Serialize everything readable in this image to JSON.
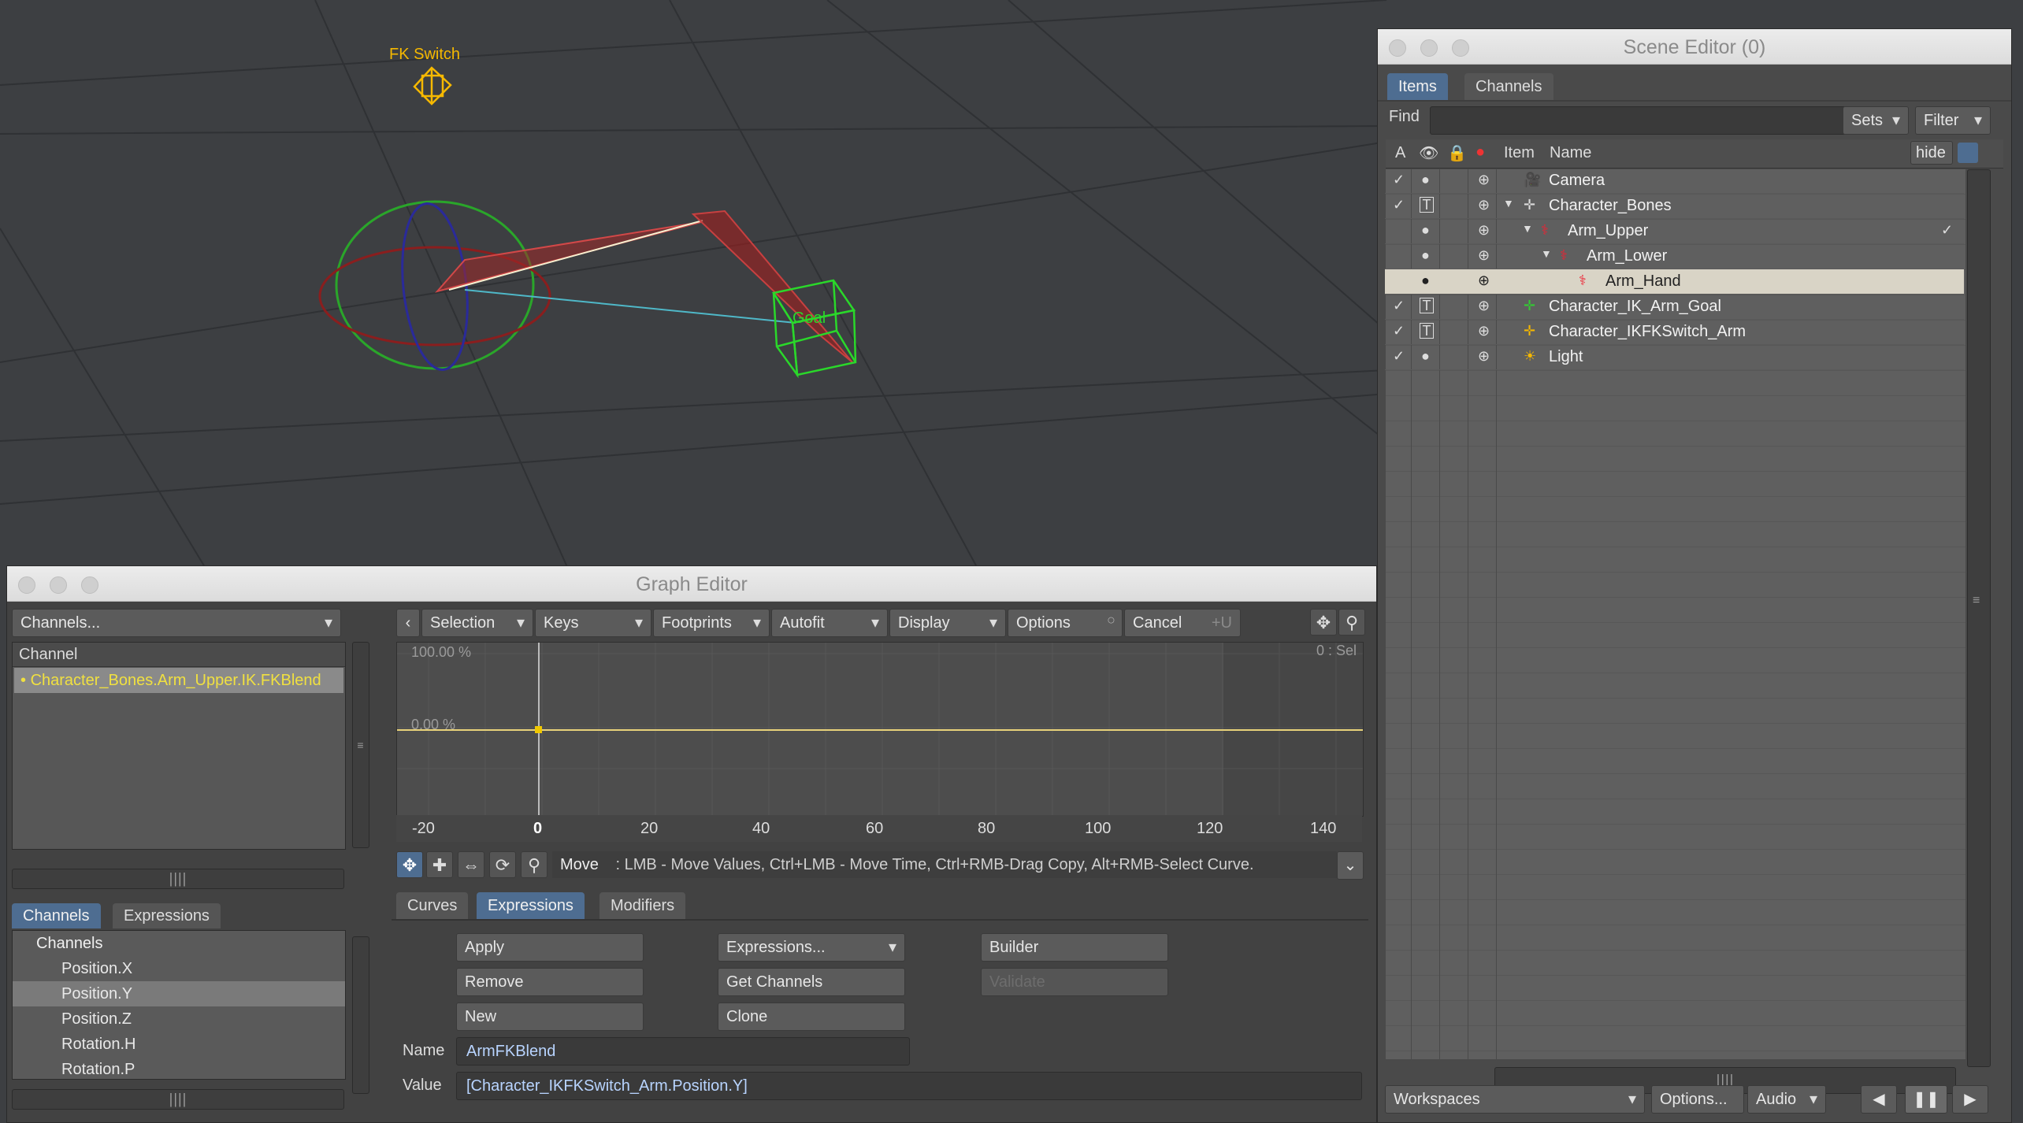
{
  "viewport": {
    "fk_switch_label": "FK Switch",
    "goal_label": "Goal"
  },
  "scene_editor": {
    "title": "Scene Editor (0)",
    "tabs": [
      "Items",
      "Channels"
    ],
    "find_label": "Find",
    "find_value": "",
    "sets_label": "Sets",
    "filter_label": "Filter",
    "col_a": "A",
    "col_item": "Item",
    "col_name": "Name",
    "hide_label": "hide",
    "items": [
      {
        "name": "Camera",
        "check": "✓",
        "vis": "●",
        "tvis": false,
        "icon": "camera-icon"
      },
      {
        "name": "Character_Bones",
        "check": "✓",
        "vis": "T",
        "tvis": true,
        "icon": "null-icon"
      },
      {
        "name": "Arm_Upper",
        "check": "",
        "vis": "●",
        "tvis": false,
        "icon": "bone-icon",
        "right": "✓"
      },
      {
        "name": "Arm_Lower",
        "check": "",
        "vis": "●",
        "tvis": false,
        "icon": "bone-icon"
      },
      {
        "name": "Arm_Hand",
        "check": "",
        "vis": "●",
        "tvis": false,
        "icon": "bone-icon"
      },
      {
        "name": "Character_IK_Arm_Goal",
        "check": "✓",
        "vis": "T",
        "tvis": true,
        "icon": "null-green-icon"
      },
      {
        "name": "Character_IKFKSwitch_Arm",
        "check": "✓",
        "vis": "T",
        "tvis": true,
        "icon": "null-yellow-icon"
      },
      {
        "name": "Light",
        "check": "✓",
        "vis": "●",
        "tvis": false,
        "icon": "light-icon"
      }
    ],
    "workspaces_label": "Workspaces",
    "options_label": "Options...",
    "audio_label": "Audio"
  },
  "graph_editor": {
    "title": "Graph Editor",
    "channels_dropdown": "Channels...",
    "channel_header": "Channel",
    "channel_item": "Character_Bones.Arm_Upper.IK.FKBlend",
    "lower_tabs": [
      "Channels",
      "Expressions"
    ],
    "channels_tree_header": "Channels",
    "channels_list": [
      "Position.X",
      "Position.Y",
      "Position.Z",
      "Rotation.H",
      "Rotation.P"
    ],
    "toolbar": {
      "selection": "Selection",
      "keys": "Keys",
      "footprints": "Footprints",
      "autofit": "Autofit",
      "display": "Display",
      "options": "Options",
      "cancel": "Cancel",
      "shortcut": "+U"
    },
    "graph": {
      "top_label": "100.00 %",
      "mid_label": "0.00 %",
      "sel_label": "0 : Sel",
      "x_ticks": [
        "-20",
        "0",
        "20",
        "40",
        "60",
        "80",
        "100",
        "120",
        "140"
      ]
    },
    "status": {
      "mode": "Move",
      "hint": ":  LMB - Move Values, Ctrl+LMB - Move Time, Ctrl+RMB-Drag Copy, Alt+RMB-Select Curve."
    },
    "bottom_tabs": [
      "Curves",
      "Expressions",
      "Modifiers"
    ],
    "buttons": {
      "apply": "Apply",
      "remove": "Remove",
      "new": "New",
      "expressions_dd": "Expressions...",
      "get_channels": "Get Channels",
      "clone": "Clone",
      "builder": "Builder",
      "validate": "Validate"
    },
    "name_label": "Name",
    "name_value": "ArmFKBlend",
    "value_label": "Value",
    "value_value": "[Character_IKFKSwitch_Arm.Position.Y]"
  },
  "colors": {
    "accent": "#4e6d91",
    "key_yellow": "#e8d27a"
  }
}
